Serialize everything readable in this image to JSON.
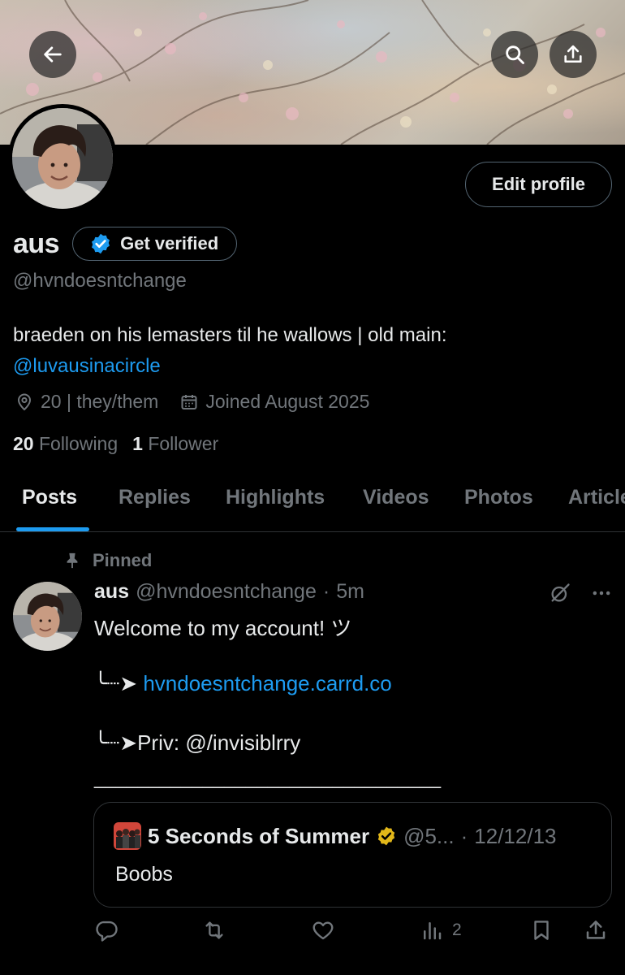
{
  "header": {
    "back_icon": "arrow-left-icon",
    "search_icon": "search-icon",
    "share_icon": "share-icon"
  },
  "profile": {
    "display_name": "aus",
    "get_verified_label": "Get verified",
    "edit_profile_label": "Edit profile",
    "handle": "@hvndoesntchange",
    "bio_text": "braeden on his lemasters til he wallows | old main:",
    "bio_mention": "@luvausinacircle",
    "location": "20 | they/them",
    "joined": "Joined August 2025",
    "following_count": "20",
    "following_label": "Following",
    "followers_count": "1",
    "followers_label": "Follower",
    "accent_color": "#1d9bf0"
  },
  "tabs": [
    {
      "label": "Posts",
      "active": true
    },
    {
      "label": "Replies",
      "active": false
    },
    {
      "label": "Highlights",
      "active": false
    },
    {
      "label": "Videos",
      "active": false
    },
    {
      "label": "Photos",
      "active": false
    },
    {
      "label": "Articles",
      "active": false
    }
  ],
  "post": {
    "pinned_label": "Pinned",
    "author_name": "aus",
    "author_handle": "@hvndoesntchange",
    "separator": "·",
    "time": "5m",
    "line1": "Welcome to my account! ツ",
    "arrow": "╰┈➤ ",
    "link": "hvndoesntchange.carrd.co",
    "priv_line": "╰┈➤Priv: @/invisiblrry",
    "divider_line": "________________________________",
    "quote": {
      "name": "5 Seconds of Summer",
      "handle": "@5...",
      "separator": "·",
      "date": "12/12/13",
      "text": "Boobs"
    },
    "actions": {
      "reply_count": "",
      "repost_count": "",
      "like_count": "",
      "views_count": "2"
    }
  }
}
